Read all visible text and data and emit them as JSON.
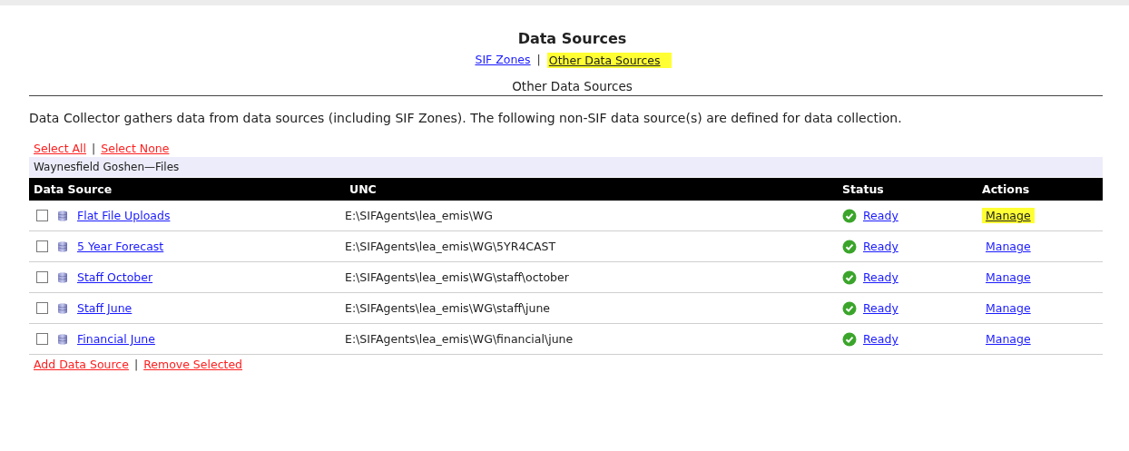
{
  "title": "Data Sources",
  "nav": [
    {
      "label": "SIF Zones",
      "highlighted": false
    },
    {
      "label": "Other Data Sources",
      "highlighted": true
    }
  ],
  "nav_separator": "|",
  "section_title": "Other Data Sources",
  "description": "Data Collector gathers data from data sources (including SIF Zones). The following non-SIF data source(s) are defined for data collection.",
  "select_links": [
    "Select All",
    "Select None"
  ],
  "select_separator": "|",
  "group": "Waynesfield Goshen—Files",
  "table": {
    "columns": [
      "Data Source",
      "UNC",
      "Status",
      "Actions"
    ],
    "rows": [
      {
        "checked": false,
        "name": "Flat File Uploads",
        "unc": "E:\\SIFAgents\\lea_emis\\WG",
        "status": "Ready",
        "action": "Manage",
        "highlighted": true
      },
      {
        "checked": false,
        "name": "5 Year Forecast",
        "unc": "E:\\SIFAgents\\lea_emis\\WG\\5YR4CAST",
        "status": "Ready",
        "action": "Manage",
        "highlighted": false
      },
      {
        "checked": false,
        "name": "Staff October",
        "unc": "E:\\SIFAgents\\lea_emis\\WG\\staff\\october",
        "status": "Ready",
        "action": "Manage",
        "highlighted": false
      },
      {
        "checked": false,
        "name": "Staff June",
        "unc": "E:\\SIFAgents\\lea_emis\\WG\\staff\\june",
        "status": "Ready",
        "action": "Manage",
        "highlighted": false
      },
      {
        "checked": false,
        "name": "Financial June",
        "unc": "E:\\SIFAgents\\lea_emis\\WG\\financial\\june",
        "status": "Ready",
        "action": "Manage",
        "highlighted": false
      }
    ]
  },
  "footer_links": [
    "Add Data Source",
    "Remove Selected"
  ],
  "footer_separator": "|"
}
